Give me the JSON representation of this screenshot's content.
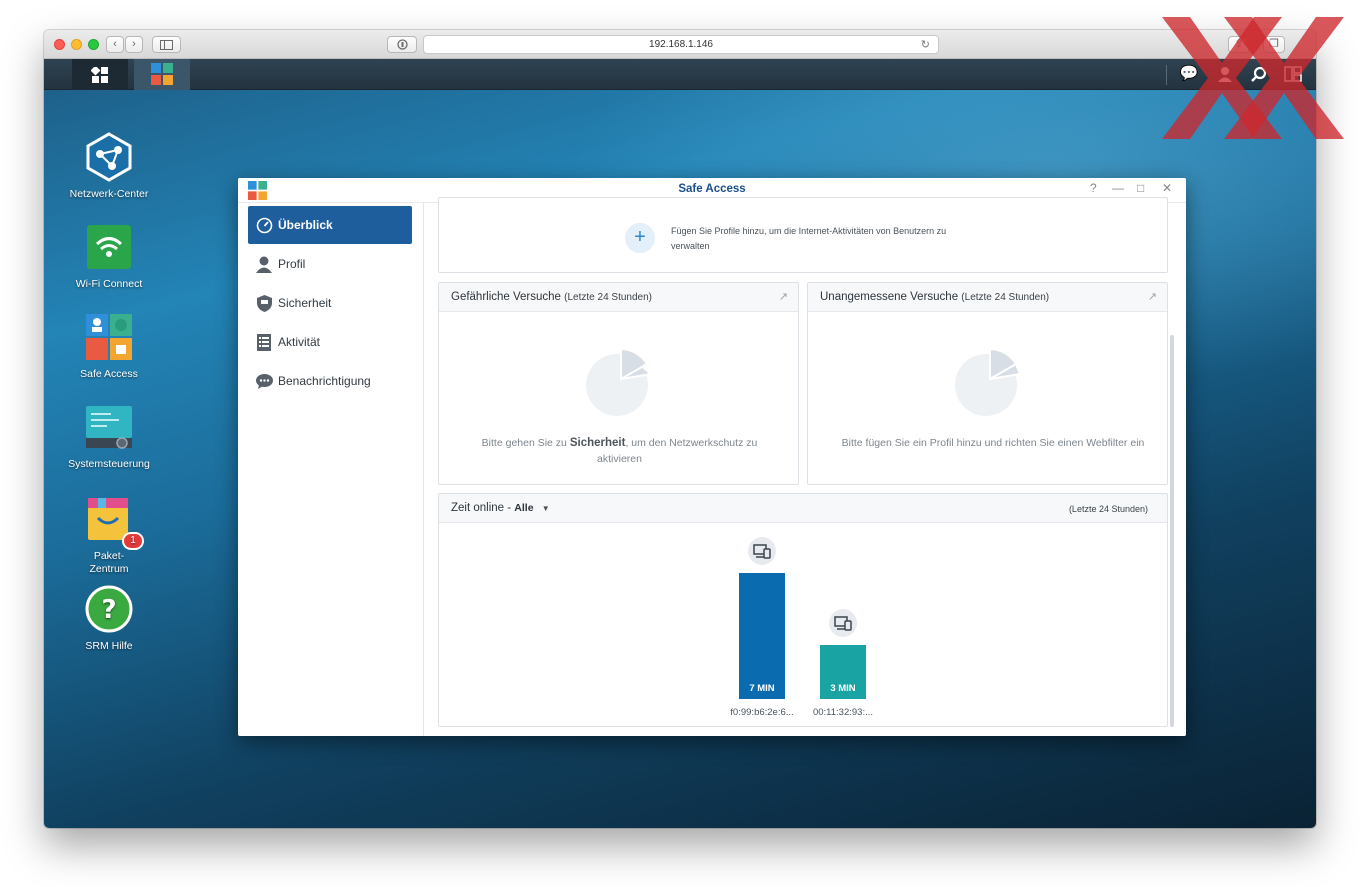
{
  "browser": {
    "url": "192.168.1.146"
  },
  "desktop": {
    "icons": [
      {
        "label": "Netzwerk-Center"
      },
      {
        "label": "Wi-Fi Connect"
      },
      {
        "label": "Safe Access"
      },
      {
        "label": "Systemsteuerung"
      },
      {
        "label": "Paket-\nZentrum",
        "line1": "Paket-",
        "line2": "Zentrum",
        "badge": "1"
      },
      {
        "label": "SRM Hilfe"
      }
    ]
  },
  "window": {
    "title": "Safe Access",
    "controls": {
      "help": "?",
      "minimize": "—",
      "maximize": "□",
      "close": "✕"
    }
  },
  "sidebar": {
    "items": [
      {
        "label": "Überblick",
        "icon": "gauge-icon",
        "active": true
      },
      {
        "label": "Profil",
        "icon": "user-icon"
      },
      {
        "label": "Sicherheit",
        "icon": "shield-icon"
      },
      {
        "label": "Aktivität",
        "icon": "list-icon"
      },
      {
        "label": "Benachrichtigung",
        "icon": "chat-icon"
      }
    ]
  },
  "profile_banner": {
    "line1": "Fügen Sie Profile hinzu, um die Internet-Aktivitäten von Benutzern zu",
    "line2": "verwalten"
  },
  "dangerous": {
    "title": "Gefährliche Versuche",
    "period": "(Letzte 24 Stunden)",
    "msg_before": "Bitte gehen Sie zu",
    "msg_bold": "Sicherheit",
    "msg_after": ", um den Netzwerkschutz zu",
    "msg_line2": "aktivieren"
  },
  "inappropriate": {
    "title": "Unangemessene Versuche",
    "period": "(Letzte 24 Stunden)",
    "msg": "Bitte fügen Sie ein Profil hinzu und richten Sie einen Webfilter ein"
  },
  "online_time": {
    "title": "Zeit online - ",
    "filter": "Alle",
    "period": "(Letzte 24 Stunden)"
  },
  "chart_data": {
    "type": "bar",
    "categories": [
      "f0:99:b6:2e:6...",
      "00:11:32:93:..."
    ],
    "values": [
      7,
      3
    ],
    "value_labels": [
      "7 MIN",
      "3 MIN"
    ],
    "colors": [
      "#0a6cae",
      "#1aa3a3"
    ],
    "unit": "MIN",
    "xlabel": "",
    "ylabel": ""
  }
}
